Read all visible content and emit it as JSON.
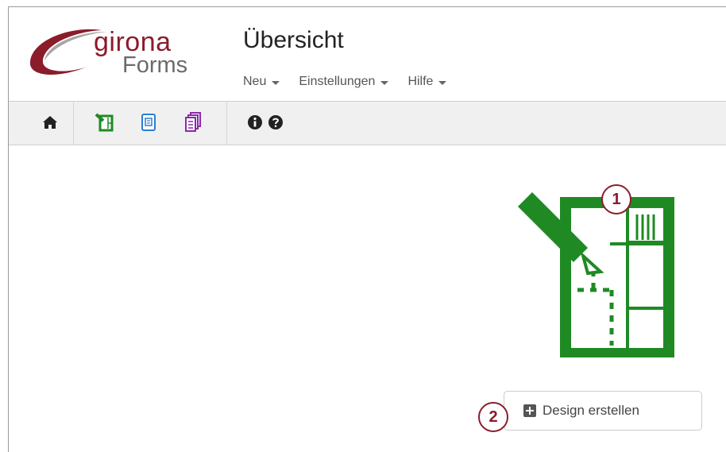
{
  "brand": {
    "line1": "girona",
    "line2": "Forms",
    "primary": "#8b1c2a",
    "secondary": "#6b6b6b"
  },
  "header": {
    "title": "Übersicht"
  },
  "menu": [
    {
      "label": "Neu"
    },
    {
      "label": "Einstellungen"
    },
    {
      "label": "Hilfe"
    }
  ],
  "toolbar": {
    "icons": [
      "home-icon",
      "design-form-icon",
      "form-document-icon",
      "multi-document-icon",
      "info-icon",
      "help-icon"
    ]
  },
  "main": {
    "illustration": "form-design-icon",
    "illustration_color": "#1f8a24",
    "create_button_label": "Design erstellen",
    "callouts": [
      "1",
      "2"
    ]
  }
}
